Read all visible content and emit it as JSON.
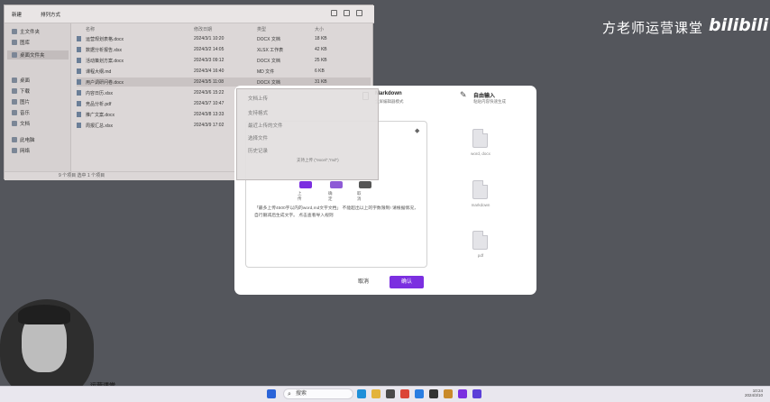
{
  "watermark": {
    "channel": "方老师运营课堂",
    "site": "bilibili"
  },
  "explorer": {
    "toolbar": {
      "new_label": "新建",
      "sort_label": "排列方式"
    },
    "sidebar": [
      {
        "label": "主文件夹",
        "icon": "home-icon"
      },
      {
        "label": "图库",
        "icon": "gallery-icon"
      },
      {
        "label": "桌面文件夹",
        "icon": "folder-icon",
        "active": true
      },
      {
        "label": "桌面",
        "icon": "desktop-icon"
      },
      {
        "label": "下载",
        "icon": "download-icon"
      },
      {
        "label": "图片",
        "icon": "image-icon"
      },
      {
        "label": "音乐",
        "icon": "music-icon"
      },
      {
        "label": "文档",
        "icon": "document-icon"
      },
      {
        "label": "此电脑",
        "icon": "computer-icon"
      },
      {
        "label": "网络",
        "icon": "network-icon"
      }
    ],
    "columns": {
      "name": "名称",
      "date": "修改日期",
      "type": "类型",
      "size": "大小"
    },
    "rows": [
      {
        "name": "运营规划表格.docx",
        "date": "2024/3/1 10:20",
        "type": "DOCX 文档",
        "size": "18 KB"
      },
      {
        "name": "数据分析报告.xlsx",
        "date": "2024/3/2 14:05",
        "type": "XLSX 工作表",
        "size": "42 KB"
      },
      {
        "name": "活动策划方案.docx",
        "date": "2024/3/3 09:12",
        "type": "DOCX 文档",
        "size": "25 KB"
      },
      {
        "name": "课程大纲.md",
        "date": "2024/3/4 16:40",
        "type": "MD 文件",
        "size": "6 KB"
      },
      {
        "name": "用户调研问卷.docx",
        "date": "2024/3/5 11:08",
        "type": "DOCX 文档",
        "size": "31 KB"
      },
      {
        "name": "内容日历.xlsx",
        "date": "2024/3/6 15:22",
        "type": "XLSX 工作表",
        "size": "19 KB"
      },
      {
        "name": "竞品分析.pdf",
        "date": "2024/3/7 10:47",
        "type": "PDF 文件",
        "size": "512 KB"
      },
      {
        "name": "推广文案.docx",
        "date": "2024/3/8 13:33",
        "type": "DOCX 文档",
        "size": "14 KB"
      },
      {
        "name": "周报汇总.xlsx",
        "date": "2024/3/9 17:02",
        "type": "XLSX 工作表",
        "size": "28 KB"
      }
    ],
    "status": "9 个项目  选中 1 个项目"
  },
  "popup": {
    "items": [
      "文档上传",
      "支持格式",
      "最近上传的文件",
      "选择文件",
      "历史记录"
    ],
    "hint": "支持上传 (\"excel\",\"md\")",
    "options": [
      {
        "label": "上传",
        "color": "#7b2fe0"
      },
      {
        "label": "确定",
        "color": "#8e5bd6"
      },
      {
        "label": "取消",
        "color": "#555555"
      }
    ]
  },
  "dialog": {
    "markdown": {
      "title": "Markdown",
      "subtitle": "全屏编辑器模式"
    },
    "custom_input": {
      "title": "自由输入",
      "subtitle": "粘贴内容快速生成"
    },
    "formats": [
      "word, docx",
      "markdown",
      "pdf"
    ],
    "upload_hint": "「最多上传4500字以内的word,md文字文档」 不能超出以上的字数限制! 请根据情况，自行删减后生成文字。 点击查看导入规则",
    "cancel_label": "取消",
    "ok_label": "确认"
  },
  "webcam": {
    "caption": "运营课堂"
  },
  "taskbar": {
    "search_placeholder": "搜索",
    "apps": [
      {
        "name": "start-icon",
        "color": "#2b64d8"
      },
      {
        "name": "edge-icon",
        "color": "#1f8fd8"
      },
      {
        "name": "files-icon",
        "color": "#e3b33b"
      },
      {
        "name": "store-icon",
        "color": "#4a4a4a"
      },
      {
        "name": "chrome-icon",
        "color": "#db4437"
      },
      {
        "name": "mail-icon",
        "color": "#2a7de1"
      },
      {
        "name": "terminal-icon",
        "color": "#333333"
      },
      {
        "name": "notes-icon",
        "color": "#c98a2a"
      },
      {
        "name": "app-icon",
        "color": "#7b2fe0"
      },
      {
        "name": "ai-icon",
        "color": "#5b3fd8"
      }
    ],
    "time": "10:24",
    "date": "2024/3/10"
  }
}
